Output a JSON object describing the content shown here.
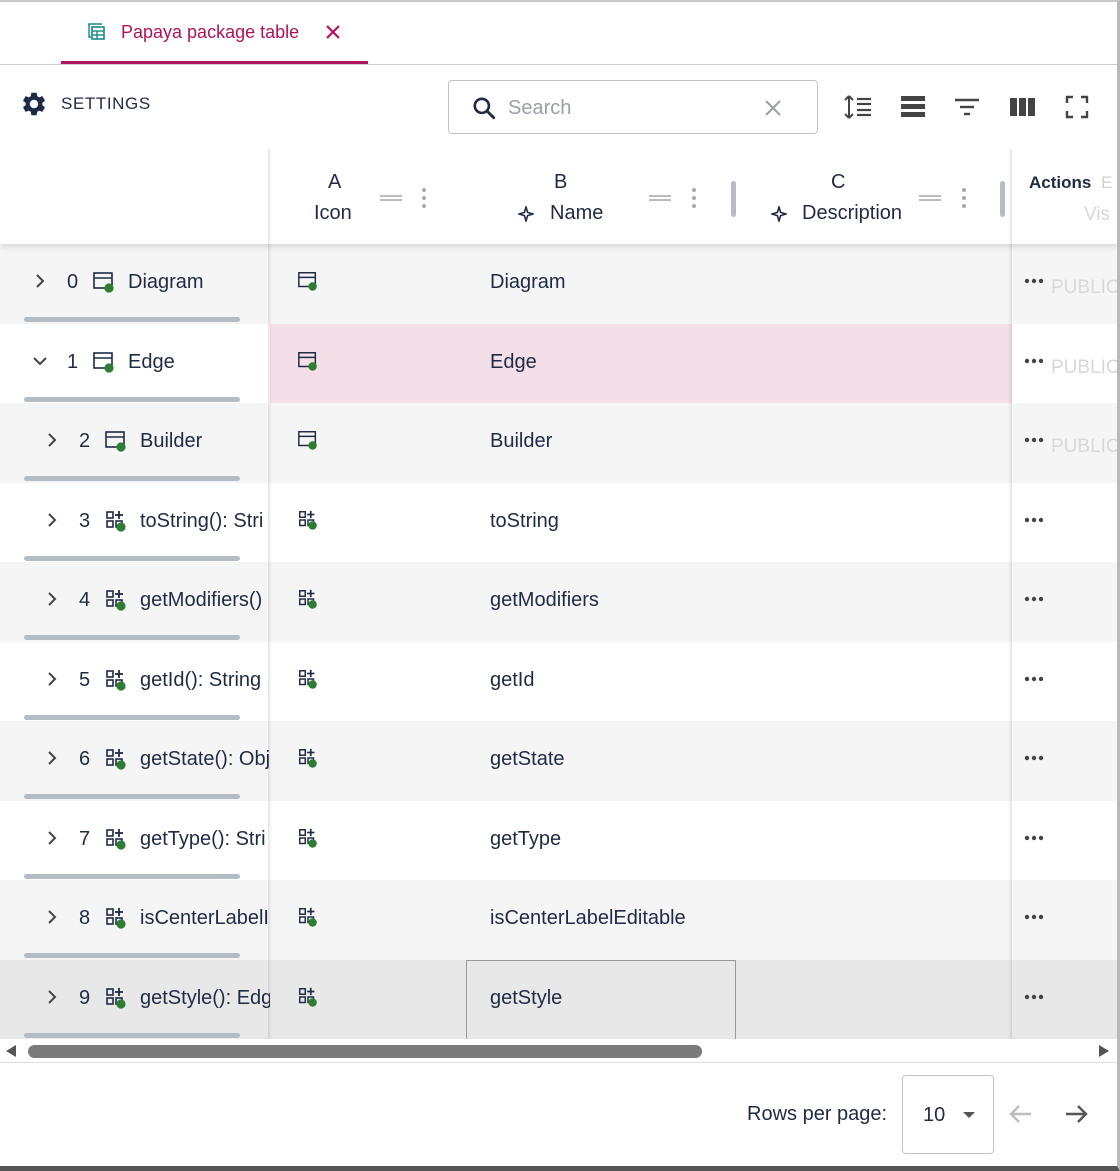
{
  "tab": {
    "title": "Papaya package table",
    "icon": "table-icon",
    "close_icon": "close-icon"
  },
  "toolbar": {
    "settings_label": "SETTINGS",
    "search_placeholder": "Search",
    "search_value": "",
    "buttons": [
      "line-height-icon",
      "density-icon",
      "filter-icon",
      "columns-icon",
      "fullscreen-icon"
    ]
  },
  "columns": [
    {
      "letter": "A",
      "name": "Icon"
    },
    {
      "letter": "B",
      "name": "Name"
    },
    {
      "letter": "C",
      "name": "Description"
    }
  ],
  "actions_header": {
    "label": "Actions",
    "partial_letter": "E",
    "partial_name": "Vis"
  },
  "rows": [
    {
      "index": "0",
      "tree_label": "Diagram",
      "name": "Diagram",
      "kind": "class",
      "expanded": false,
      "visibility": "PUBLIC"
    },
    {
      "index": "1",
      "tree_label": "Edge",
      "name": "Edge",
      "kind": "class",
      "expanded": true,
      "visibility": "PUBLIC"
    },
    {
      "index": "2",
      "tree_label": "Builder",
      "name": "Builder",
      "kind": "class",
      "expanded": false,
      "visibility": "PUBLIC"
    },
    {
      "index": "3",
      "tree_label": "toString(): Stri",
      "name": "toString",
      "kind": "method",
      "expanded": false,
      "visibility": ""
    },
    {
      "index": "4",
      "tree_label": "getModifiers()",
      "name": "getModifiers",
      "kind": "method",
      "expanded": false,
      "visibility": ""
    },
    {
      "index": "5",
      "tree_label": "getId(): String",
      "name": "getId",
      "kind": "method",
      "expanded": false,
      "visibility": ""
    },
    {
      "index": "6",
      "tree_label": "getState(): Obj",
      "name": "getState",
      "kind": "method",
      "expanded": false,
      "visibility": ""
    },
    {
      "index": "7",
      "tree_label": "getType(): Stri",
      "name": "getType",
      "kind": "method",
      "expanded": false,
      "visibility": ""
    },
    {
      "index": "8",
      "tree_label": "isCenterLabelI",
      "name": "isCenterLabelEditable",
      "kind": "method",
      "expanded": false,
      "visibility": ""
    },
    {
      "index": "9",
      "tree_label": "getStyle(): Edg",
      "name": "getStyle",
      "kind": "method",
      "expanded": false,
      "visibility": ""
    }
  ],
  "selected_row": "1",
  "active_row": "9",
  "pagination": {
    "rows_per_page_label": "Rows per page:",
    "rows_per_page": "10"
  },
  "colors": {
    "accent": "#b0125b",
    "selected_row": "#f4dfe8",
    "status_dot": "#2e7d32",
    "text": "#1f2a44"
  }
}
